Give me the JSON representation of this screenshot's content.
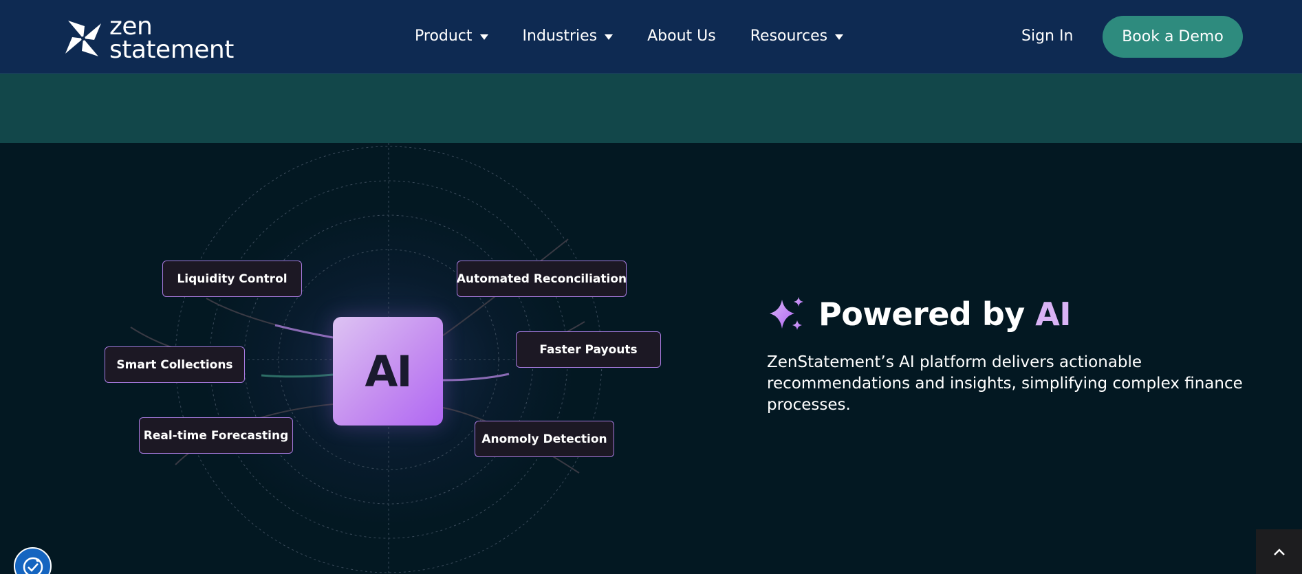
{
  "header": {
    "logo": {
      "line1": "zen",
      "line2": "statement",
      "icon": "pinwheel-icon"
    },
    "nav": [
      {
        "label": "Product",
        "has_dropdown": true
      },
      {
        "label": "Industries",
        "has_dropdown": true
      },
      {
        "label": "About Us",
        "has_dropdown": false
      },
      {
        "label": "Resources",
        "has_dropdown": true
      }
    ],
    "signin_label": "Sign In",
    "demo_label": "Book a Demo"
  },
  "diagram": {
    "center_label": "AI",
    "features": [
      "Liquidity Control",
      "Automated Reconciliation",
      "Smart Collections",
      "Faster Payouts",
      "Real-time Forecasting",
      "Anomoly Detection"
    ]
  },
  "section": {
    "title_prefix": "Powered by ",
    "title_accent": "AI",
    "description": "ZenStatement’s AI platform delivers actionable recommendations and insights, simplifying complex finance processes."
  },
  "colors": {
    "header_bg": "#0e2a52",
    "band_bg": "#12474a",
    "main_bg": "#031822",
    "accent_teal": "#2e8b7e",
    "accent_purple": "#b067f3"
  },
  "icons": {
    "sparkle": "sparkle-icon",
    "accessibility": "accessibility-icon",
    "scroll_top": "chevron-up-icon"
  }
}
